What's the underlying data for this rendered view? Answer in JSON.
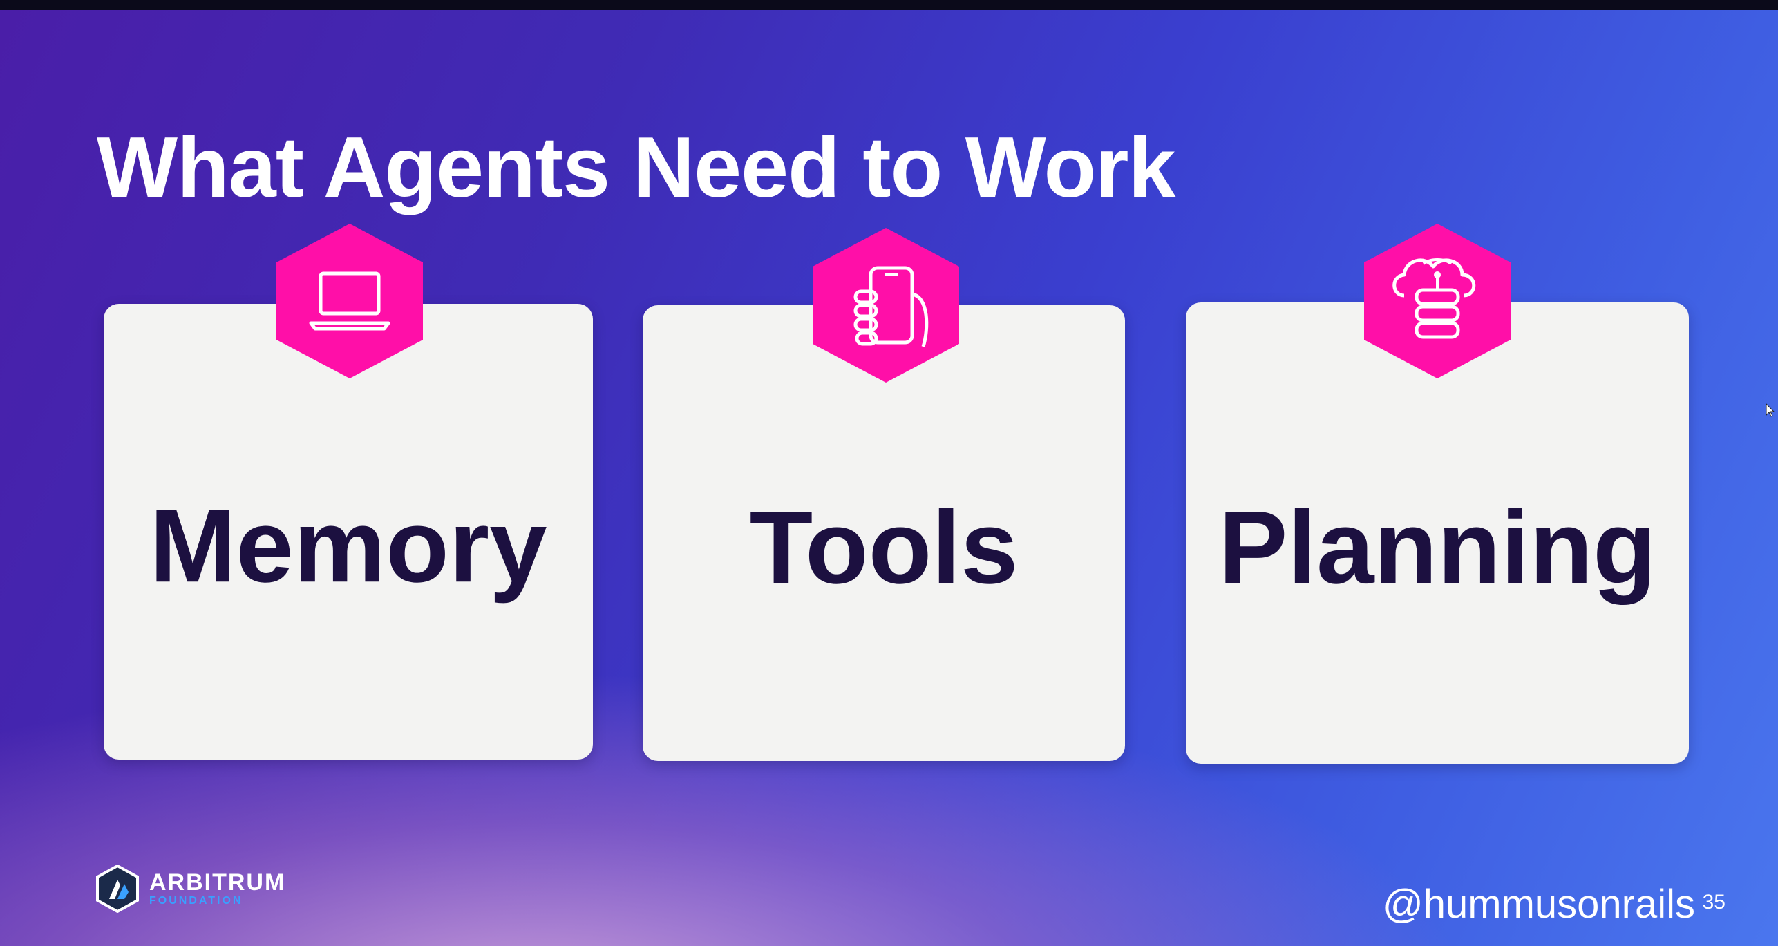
{
  "slide": {
    "title": "What Agents Need to Work",
    "cards": [
      {
        "label": "Memory",
        "icon": "laptop-icon"
      },
      {
        "label": "Tools",
        "icon": "smartphone-in-hand-icon"
      },
      {
        "label": "Planning",
        "icon": "cloud-database-icon"
      }
    ],
    "logo": {
      "name": "ARBITRUM",
      "subtitle": "FOUNDATION"
    },
    "handle": "@hummusonrails",
    "page_number": "35"
  },
  "colors": {
    "background_left": "#4a1ea8",
    "background_right": "#4a76ee",
    "card_background": "#f3f3f2",
    "card_text": "#1c1040",
    "hexagon_accent": "#ff0fa8",
    "logo_accent": "#3aa0ff"
  }
}
